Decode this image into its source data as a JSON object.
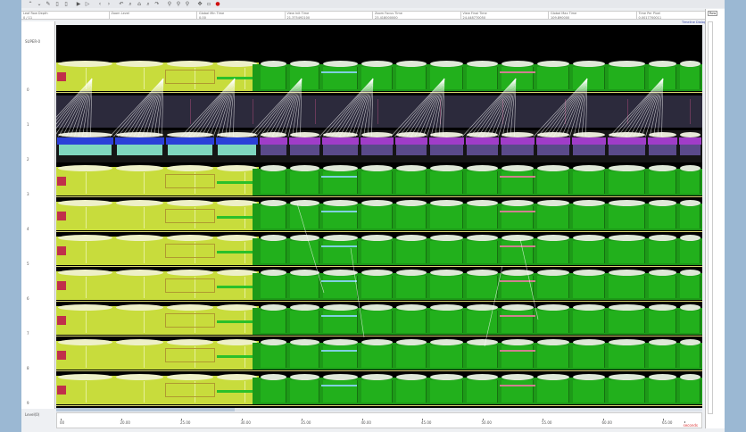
{
  "toolbar": {
    "icons": [
      "up-icon",
      "down-icon",
      "edit-icon",
      "delete-icon",
      "delete-icon",
      "play-icon",
      "step-icon",
      "back-icon",
      "forward-icon",
      "undo-icon",
      "zoom-in-icon",
      "home-icon",
      "zoom-out-icon",
      "redo-icon",
      "search-icon",
      "search-backward-icon",
      "search-forward-icon",
      "settings-icon",
      "blank-icon",
      "stop-icon"
    ]
  },
  "info": {
    "fields": [
      {
        "label": "Leaf Row Depth",
        "value": "0 / 11"
      },
      {
        "label": "Zoom Level",
        "value": ""
      },
      {
        "label": "Global Min Time",
        "value": "0.00"
      },
      {
        "label": "View Init Time",
        "value": "21.375492100"
      },
      {
        "label": "Zoom Focus Time",
        "value": "23.418000000"
      },
      {
        "label": "View Final Time",
        "value": "24.448770050"
      },
      {
        "label": "Global Max Time",
        "value": "109.890000"
      },
      {
        "label": "Time Per Pixel",
        "value": "0.0017700011"
      }
    ],
    "legend_link": "Timeline Dialog",
    "legend_select": "Row"
  },
  "left": {
    "root": "SUPER-0",
    "rows": [
      "0",
      "1",
      "2",
      "3",
      "4",
      "5",
      "6",
      "7",
      "8",
      "9"
    ],
    "bottom": "Level(0)"
  },
  "axis": {
    "ticks": [
      "00",
      "20.00",
      "25.00",
      "30.00",
      "35.00",
      "40.00",
      "45.00",
      "50.00",
      "55.00",
      "60.00",
      "65.00"
    ],
    "note": "seconds"
  },
  "colors": {
    "yellow": "#c8dc3c",
    "green": "#22b01c",
    "dark": "#2c2a3c",
    "teal": "#7fd6be",
    "blue": "#2b3fd8",
    "purple": "#a03cc8",
    "red": "#c0304a"
  }
}
